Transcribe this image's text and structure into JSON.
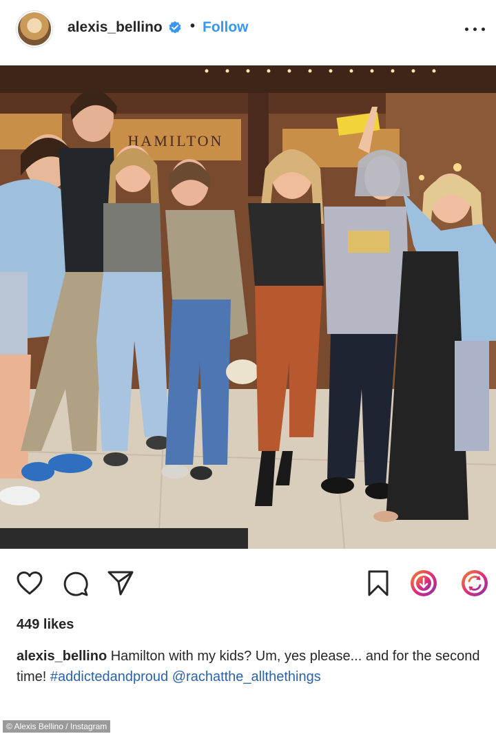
{
  "header": {
    "username": "alexis_bellino",
    "separator": "•",
    "follow_label": "Follow",
    "verified_icon": "verified-badge-icon",
    "more_icon": "more-options-icon"
  },
  "photo": {
    "marquee_text": "HAMILTON",
    "theme_colors": {
      "marquee": "#c98e47",
      "floor": "#d9cdbb",
      "ceiling": "#4a2a1c"
    }
  },
  "actions": {
    "like_icon": "heart-icon",
    "comment_icon": "comment-icon",
    "share_icon": "paper-plane-icon",
    "save_icon": "bookmark-icon",
    "download_icon": "download-circle-icon",
    "repost_icon": "repost-circle-icon",
    "accent_gradient": [
      "#f58529",
      "#dd2a7b",
      "#8134af"
    ]
  },
  "likes": {
    "text": "449 likes"
  },
  "caption": {
    "username": "alexis_bellino",
    "text": "Hamilton with my kids? Um, yes please... and for the second time!",
    "hashtag": "#addictedandproud",
    "mention": "@rachatthe_allthethings"
  },
  "credit": {
    "text": "© Alexis Bellino / Instagram"
  }
}
